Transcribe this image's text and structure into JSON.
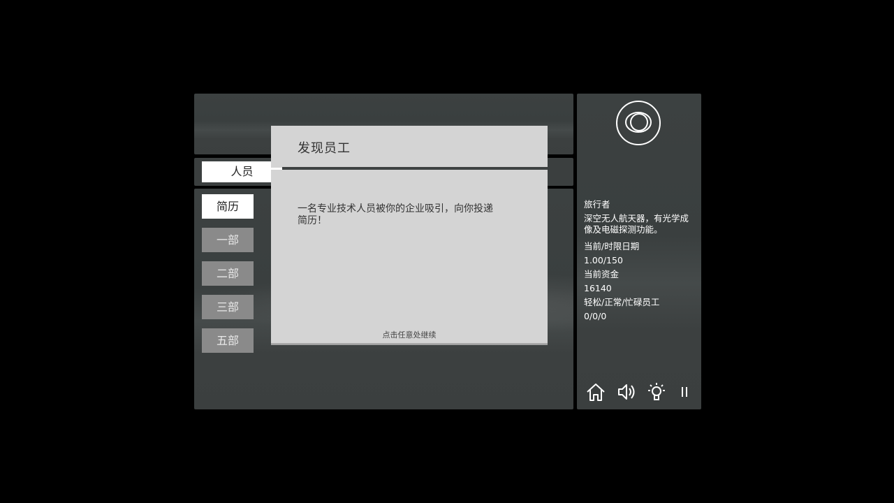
{
  "tabs": {
    "people_label": "人员"
  },
  "menu": [
    {
      "label": "简历",
      "active": true
    },
    {
      "label": "一部",
      "active": false
    },
    {
      "label": "二部",
      "active": false
    },
    {
      "label": "三部",
      "active": false
    },
    {
      "label": "五部",
      "active": false
    }
  ],
  "dialog": {
    "title": "发现员工",
    "body": "一名专业技术人员被你的企业吸引，向你投递简历！",
    "footer": "点击任意处继续"
  },
  "side": {
    "logo_icon": "orbit-logo-icon",
    "drone_name": "旅行者",
    "drone_desc": "深空无人航天器，有光学成像及电磁探测功能。",
    "date_label": "当前/时限日期",
    "date_value": "1.00/150",
    "funds_label": "当前资金",
    "funds_value": "16140",
    "staff_label": "轻松/正常/忙碌员工",
    "staff_value": "0/0/0"
  },
  "toolbar": {
    "icons": [
      "home-icon",
      "sound-icon",
      "hint-bulb-icon",
      "pause-icon"
    ]
  },
  "colors": {
    "panel": "#3b3f3f",
    "dialog": "#d4d4d4",
    "active_button": "#ffffff",
    "inactive_button": "#8a8a8a"
  }
}
